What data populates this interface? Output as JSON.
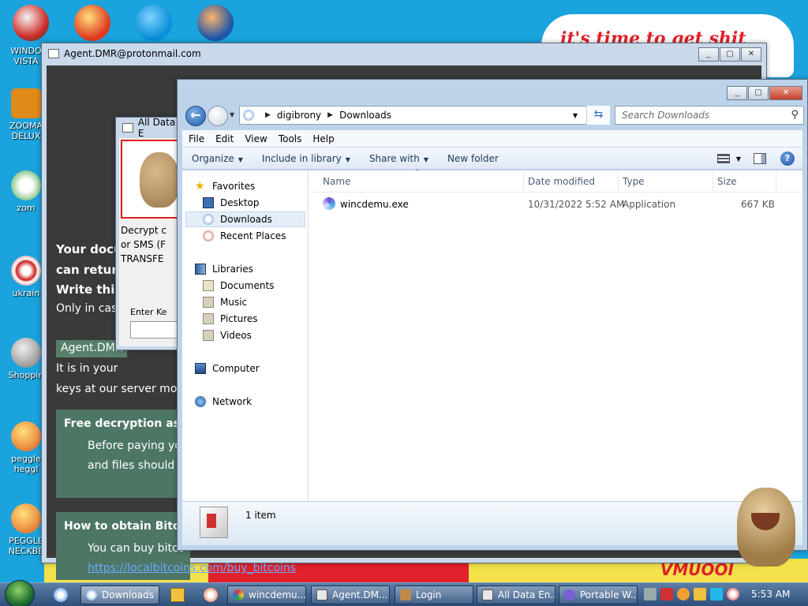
{
  "wallpaper": {
    "cloud_text": "it's time to get shit",
    "strip_text": "VMUOOI"
  },
  "desktop_icons": [
    {
      "name": "WINDOWS VISTA",
      "label1": "WINDO",
      "label2": "VISTA",
      "color": "#d0302a"
    },
    {
      "name": "ZOOMA DELUXE",
      "label1": "ZOOMA",
      "label2": "DELUX",
      "color": "#e08a1a"
    },
    {
      "name": "zombies",
      "label1": "zom",
      "label2": "",
      "color": "#3aa040"
    },
    {
      "name": "ukraine",
      "label1": "ukrain",
      "label2": "",
      "color": "#cc2020"
    },
    {
      "name": "Shopping",
      "label1": "Shoppin",
      "label2": "",
      "color": "#777777"
    },
    {
      "name": "peggle heggle",
      "label1": "peggle",
      "label2": "heggl",
      "color": "#e05a20"
    },
    {
      "name": "PEGGLE NECKBEARD",
      "label1": "PEGGLE",
      "label2": "NECKBE",
      "color": "#e05a20"
    }
  ],
  "ransom_window": {
    "title": "Agent.DMR@protonmail.com",
    "line1": "Your docu",
    "line2": "can return",
    "line3": "Write this",
    "line4": "Only in case",
    "email": "Agent.DMR",
    "line5": "It is in your",
    "line6": "keys at our server mo",
    "box1_heading": "Free decryption as",
    "box1_text1": "Before paying you",
    "box1_text2": "and files should n",
    "box2_heading": "How to obtain Bitco",
    "box2_text1": "You can buy bitco",
    "box2_link": "https://localbitcoins.com/buy_bitcoins"
  },
  "encrypted_window": {
    "title": "All Data E",
    "text1": "Decrypt c",
    "text2": "or SMS (F",
    "text3": "TRANSFE",
    "key_label": "Enter Ke"
  },
  "explorer": {
    "breadcrumb": [
      "digibrony",
      "Downloads"
    ],
    "search_placeholder": "Search Downloads",
    "menu": [
      "File",
      "Edit",
      "View",
      "Tools",
      "Help"
    ],
    "commands": {
      "organize": "Organize",
      "include": "Include in library",
      "share": "Share with",
      "new_folder": "New folder"
    },
    "nav": {
      "favorites": "Favorites",
      "desktop": "Desktop",
      "downloads": "Downloads",
      "recent": "Recent Places",
      "libraries": "Libraries",
      "documents": "Documents",
      "music": "Music",
      "pictures": "Pictures",
      "videos": "Videos",
      "computer": "Computer",
      "network": "Network"
    },
    "columns": {
      "name": "Name",
      "date": "Date modified",
      "type": "Type",
      "size": "Size"
    },
    "files": [
      {
        "name": "wincdemu.exe",
        "date": "10/31/2022 5:52 AM",
        "type": "Application",
        "size": "667 KB"
      }
    ],
    "status": "1 item"
  },
  "taskbar": {
    "buttons": [
      {
        "label": "Downloads",
        "color": "#f0c040"
      },
      {
        "label": "wincdemu...",
        "color": "#2f9e44"
      },
      {
        "label": "Agent.DM...",
        "color": "#e8e8e8"
      },
      {
        "label": "Login",
        "color": "#c08a4a"
      },
      {
        "label": "All Data En...",
        "color": "#e8e8e8"
      },
      {
        "label": "Portable W...",
        "color": "#7a5fd8"
      }
    ],
    "clock": "5:53 AM"
  }
}
